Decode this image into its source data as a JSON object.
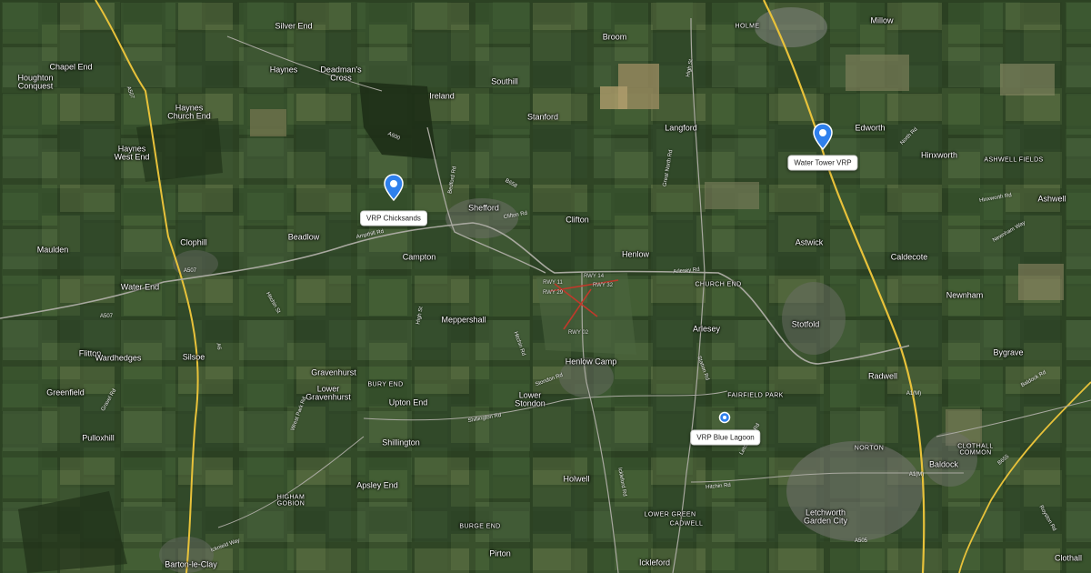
{
  "places": {
    "silver_end": "Silver End",
    "chapel_end": "Chapel End",
    "haynes": "Haynes",
    "deadmans_cross": "Deadman's\nCross",
    "houghton_conquest": "Houghton\nConquest",
    "ireland": "Ireland",
    "southill": "Southill",
    "broom": "Broom",
    "holme": "HOLME",
    "millow": "Millow",
    "haynes_church_end": "Haynes\nChurch End",
    "stanford": "Stanford",
    "langford": "Langford",
    "edworth": "Edworth",
    "haynes_west_end": "Haynes\nWest End",
    "hinxworth": "Hinxworth",
    "ashwell_fields": "ASHWELL FIELDS",
    "ashwell": "Ashwell",
    "shefford": "Shefford",
    "clifton": "Clifton",
    "maulden": "Maulden",
    "beadlow": "Beadlow",
    "clophill": "Clophill",
    "astwick": "Astwick",
    "caldecote": "Caldecote",
    "henlow": "Henlow",
    "campton": "Campton",
    "water_end": "Water End",
    "church_end": "CHURCH END",
    "newnham": "Newnham",
    "meppershall": "Meppershall",
    "arlesey": "Arlesey",
    "stotfold": "Stotfold",
    "flitton": "Flitton",
    "wardhedges": "Wardhedges",
    "silsoe": "Silsoe",
    "bygrave": "Bygrave",
    "henlow_camp": "Henlow Camp",
    "gravenhurst": "Gravenhurst",
    "radwell": "Radwell",
    "greenfield": "Greenfield",
    "bury_end": "BURY END",
    "lower_gravenhurst": "Lower\nGravenhurst",
    "upton_end": "Upton End",
    "lower_stondon": "Lower\nStondon",
    "fairfield_park": "FAIRFIELD PARK",
    "pulloxhill": "Pulloxhill",
    "shillington": "Shillington",
    "norton": "NORTON",
    "clothall_common": "CLOTHALL\nCOMMON",
    "baldock": "Baldock",
    "holwell": "Holwell",
    "apsley_end": "Apsley End",
    "higham_gobion": "HIGHAM\nGOBION",
    "letchworth": "Letchworth\nGarden City",
    "lower_green": "LOWER GREEN",
    "cadwell": "CADWELL",
    "burge_end": "BURGE END",
    "pirton": "Pirton",
    "barton": "Barton-le-Clay",
    "ickleford": "Ickleford",
    "clothall": "Clothall"
  },
  "roads": {
    "a507a": "A507",
    "a507b": "A507",
    "a507c": "A507",
    "a600": "A600",
    "a6": "A6",
    "a1m_a": "A1(M)",
    "a1m_b": "A1(M)",
    "b658": "B658",
    "a505": "A505",
    "b1040": "B1040",
    "b655": "B655",
    "ampthill_rd": "Ampthill Rd",
    "bedford_rd": "Bedford Rd",
    "hitchin_rd": "Hitchin Rd",
    "shillington_rd": "Shillington Rd",
    "stondon_rd": "Stondon Rd",
    "high_st": "High St",
    "hitchin_st": "Hitchin St",
    "icknield_way": "Icknield Way",
    "letchworth_rd": "Letchworth Rd",
    "arlesey_rd": "Arlesey Rd",
    "hinxworth_rd": "Hinxworth Rd",
    "newnham_way": "Newnham Way",
    "baldock_rd": "Baldock Rd",
    "gravel_rd": "Gravel Rd",
    "wrest_park": "Wrest Park Rd",
    "ickleford_rd": "Ickleford Rd",
    "hitchin_rd2": "Hitchin Rd",
    "station_rd": "Station Rd",
    "clifton_rd": "Clifton Rd",
    "great_north_rd": "Great North Rd",
    "high_st2": "High St",
    "north_rd": "North Rd",
    "royston_rd": "Royston Rd"
  },
  "vrp_markers": [
    {
      "label": "VRP Chicksands",
      "icon": "map-pin-icon"
    },
    {
      "label": "Water Tower VRP",
      "icon": "map-pin-icon"
    },
    {
      "label": "VRP Blue Lagoon",
      "icon": "map-pin-icon"
    }
  ],
  "airfield": {
    "runways": [
      "RWY 11",
      "RWY 29",
      "RWY 14",
      "RWY 32",
      "RWY 02"
    ],
    "line_color": "#c0392b"
  },
  "colors": {
    "marker_blue": "#2f80ed",
    "major_road": "#e8c23a",
    "minor_road": "#a9a9a0"
  }
}
